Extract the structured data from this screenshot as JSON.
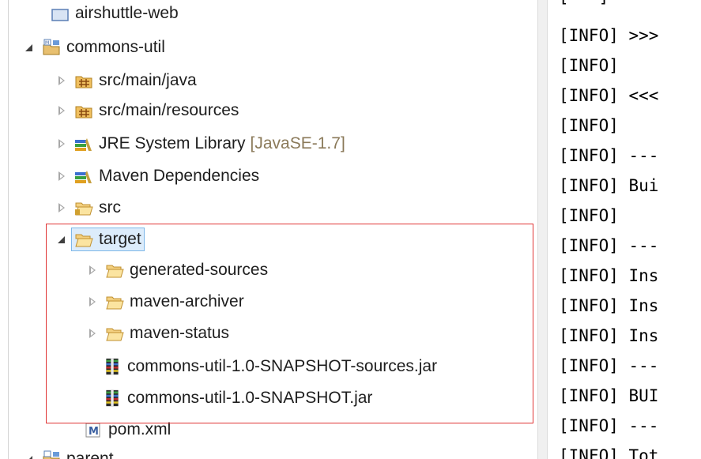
{
  "explorer": {
    "items": [
      {
        "label": "airshuttle-web",
        "icon": "project-icon",
        "twisty": "none"
      },
      {
        "label": "commons-util",
        "icon": "maven-project-icon",
        "twisty": "expanded"
      },
      {
        "label": "src/main/java",
        "icon": "source-folder-icon",
        "twisty": "collapsed"
      },
      {
        "label": "src/main/resources",
        "icon": "source-folder-icon",
        "twisty": "collapsed"
      },
      {
        "label": "JRE System Library",
        "decoration": "[JavaSE-1.7]",
        "icon": "library-icon",
        "twisty": "collapsed"
      },
      {
        "label": "Maven Dependencies",
        "icon": "library-icon",
        "twisty": "collapsed"
      },
      {
        "label": "src",
        "icon": "folder-icon",
        "twisty": "collapsed"
      },
      {
        "label": "target",
        "icon": "folder-icon",
        "twisty": "expanded",
        "selected": true
      },
      {
        "label": "generated-sources",
        "icon": "folder-icon",
        "twisty": "collapsed"
      },
      {
        "label": "maven-archiver",
        "icon": "folder-icon",
        "twisty": "collapsed"
      },
      {
        "label": "maven-status",
        "icon": "folder-icon",
        "twisty": "collapsed"
      },
      {
        "label": "commons-util-1.0-SNAPSHOT-sources.jar",
        "icon": "jar-icon",
        "twisty": "none"
      },
      {
        "label": "commons-util-1.0-SNAPSHOT.jar",
        "icon": "jar-icon",
        "twisty": "none"
      },
      {
        "label": "pom.xml",
        "icon": "maven-file-icon",
        "twisty": "none"
      },
      {
        "label": "parent",
        "icon": "maven-project-icon",
        "twisty": "expanded"
      }
    ]
  },
  "console": {
    "lines": [
      "[INFO] >>>",
      "[INFO]",
      "[INFO] <<<",
      "[INFO]",
      "[INFO] ---",
      "[INFO] Bui",
      "[INFO]",
      "[INFO] ---",
      "[INFO] Ins",
      "[INFO] Ins",
      "[INFO] Ins",
      "[INFO] ---",
      "[INFO] BUI",
      "[INFO] ---",
      "[INFO] Tot"
    ]
  },
  "colors": {
    "highlight_box": "#e03535",
    "selection_bg": "#dcecfb",
    "selection_border": "#7db7e8",
    "decoration_text": "#8b7a5a"
  }
}
